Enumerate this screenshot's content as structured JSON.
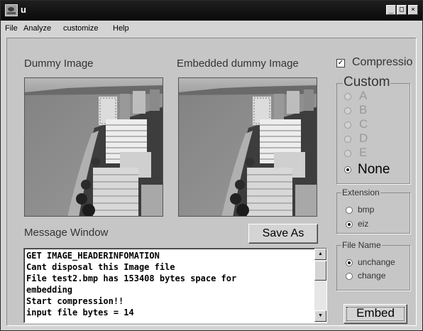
{
  "window": {
    "title": "u"
  },
  "titlebar_buttons": {
    "minimize": "_",
    "maximize": "□",
    "close": "×"
  },
  "menu": [
    "File",
    "Analyze",
    "customize",
    "Help"
  ],
  "labels": {
    "dummy_image": "Dummy Image",
    "embedded_image": "Embedded dummy Image",
    "message_window": "Message Window"
  },
  "compression": {
    "label": "Compressio",
    "checked": true,
    "check_mark": "✓"
  },
  "custom_group": {
    "title": "Custom",
    "options": [
      "A",
      "B",
      "C",
      "D",
      "E",
      "None"
    ],
    "selected": "None"
  },
  "extension_group": {
    "title": "Extension",
    "options": [
      "bmp",
      "eiz"
    ],
    "selected": "eiz"
  },
  "filename_group": {
    "title": "File Name",
    "options": [
      "unchange",
      "change"
    ],
    "selected": "unchange"
  },
  "buttons": {
    "save_as": "Save As",
    "embed": "Embed"
  },
  "scrollbar": {
    "up": "▲",
    "down": "▼"
  },
  "message_lines": [
    "GET IMAGE_HEADERINFOMATION",
    "Cant disposal this Image file",
    "File test2.bmp has 153408 bytes space for",
    "embedding",
    "Start compression!!",
    "input file bytes = 14"
  ]
}
